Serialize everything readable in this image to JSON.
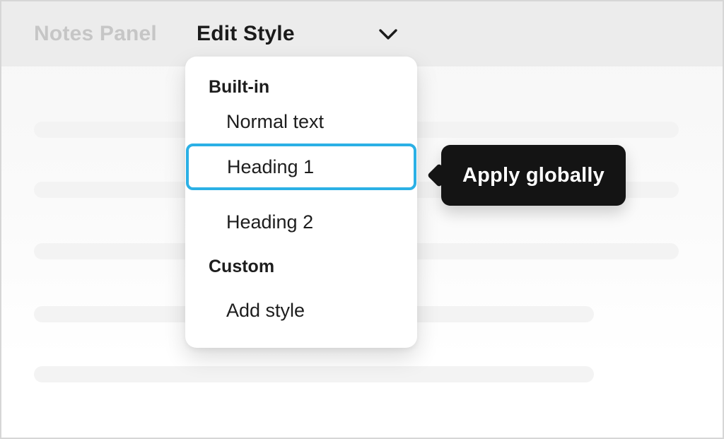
{
  "header": {
    "panel_title": "Notes Panel",
    "dropdown_label": "Edit Style",
    "chevron_icon": "chevron-down"
  },
  "menu": {
    "sections": [
      {
        "header": "Built-in",
        "items": [
          {
            "label": "Normal text",
            "selected": false
          },
          {
            "label": "Heading 1",
            "selected": true
          },
          {
            "label": "Heading 2",
            "selected": false
          }
        ]
      },
      {
        "header": "Custom",
        "items": [
          {
            "label": "Add style",
            "selected": false
          }
        ]
      }
    ],
    "selected_item": "Heading 1"
  },
  "tooltip": {
    "label": "Apply globally"
  },
  "colors": {
    "accent": "#2bb0e5",
    "tooltip_bg": "#141414",
    "header_bg": "#ececec",
    "muted_text": "#c6c6c6",
    "text": "#1d1d1d",
    "skeleton_line": "#f3f3f3",
    "panel_bg": "#ffffff"
  },
  "skeleton": {
    "line_count": 5
  }
}
